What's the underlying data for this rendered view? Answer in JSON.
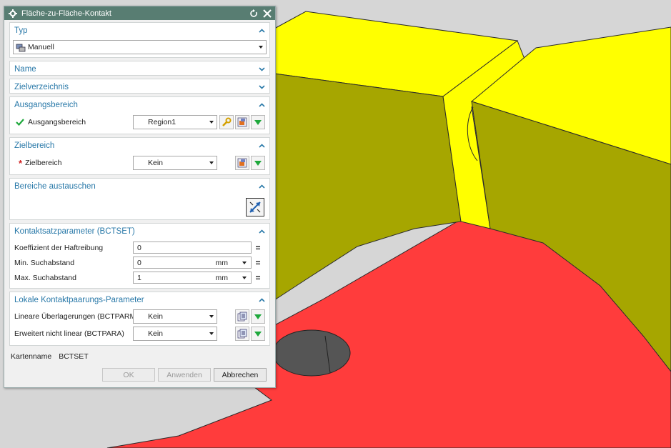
{
  "dialog": {
    "title": "Fläche-zu-Fläche-Kontakt",
    "icons": {
      "title": "gear-icon",
      "reset": "reset-icon",
      "close": "close-icon"
    }
  },
  "typ": {
    "header": "Typ",
    "combo_value": "Manuell",
    "combo_icon": "manual-contact-icon"
  },
  "name": {
    "header": "Name"
  },
  "zielverzeichnis": {
    "header": "Zielverzeichnis"
  },
  "ausgangsbereich": {
    "header": "Ausgangsbereich",
    "label": "Ausgangsbereich",
    "value": "Region1",
    "status_icon": "checkmark-icon"
  },
  "zielbereich": {
    "header": "Zielbereich",
    "label": "Zielbereich",
    "value": "Kein",
    "required_marker": "*"
  },
  "bereiche_austauschen": {
    "header": "Bereiche austauschen",
    "button_icon": "swap-regions-icon"
  },
  "kontaktsatz": {
    "header": "Kontaktsatzparameter (BCTSET)",
    "rows": [
      {
        "label": "Koeffizient der Haftreibung",
        "value": "0",
        "unit": ""
      },
      {
        "label": "Min. Suchabstand",
        "value": "0",
        "unit": "mm"
      },
      {
        "label": "Max. Suchabstand",
        "value": "1",
        "unit": "mm"
      }
    ]
  },
  "lokale": {
    "header": "Lokale Kontaktpaarungs-Parameter",
    "rows": [
      {
        "label": "Lineare Überlagerungen (BCTPARM)",
        "value": "Kein"
      },
      {
        "label": "Erweitert nicht linear (BCTPARA)",
        "value": "Kein"
      }
    ]
  },
  "kartenname": {
    "label": "Kartenname",
    "value": "BCTSET"
  },
  "buttons": {
    "ok": "OK",
    "apply": "Anwenden",
    "cancel": "Abbrechen"
  },
  "colors": {
    "titlebar": "#587d72",
    "section_header": "#2878a8",
    "model_red": "#ff3c3c",
    "model_yellow": "#ffff00",
    "model_olive": "#a6a600",
    "background": "#d6d6d6"
  }
}
